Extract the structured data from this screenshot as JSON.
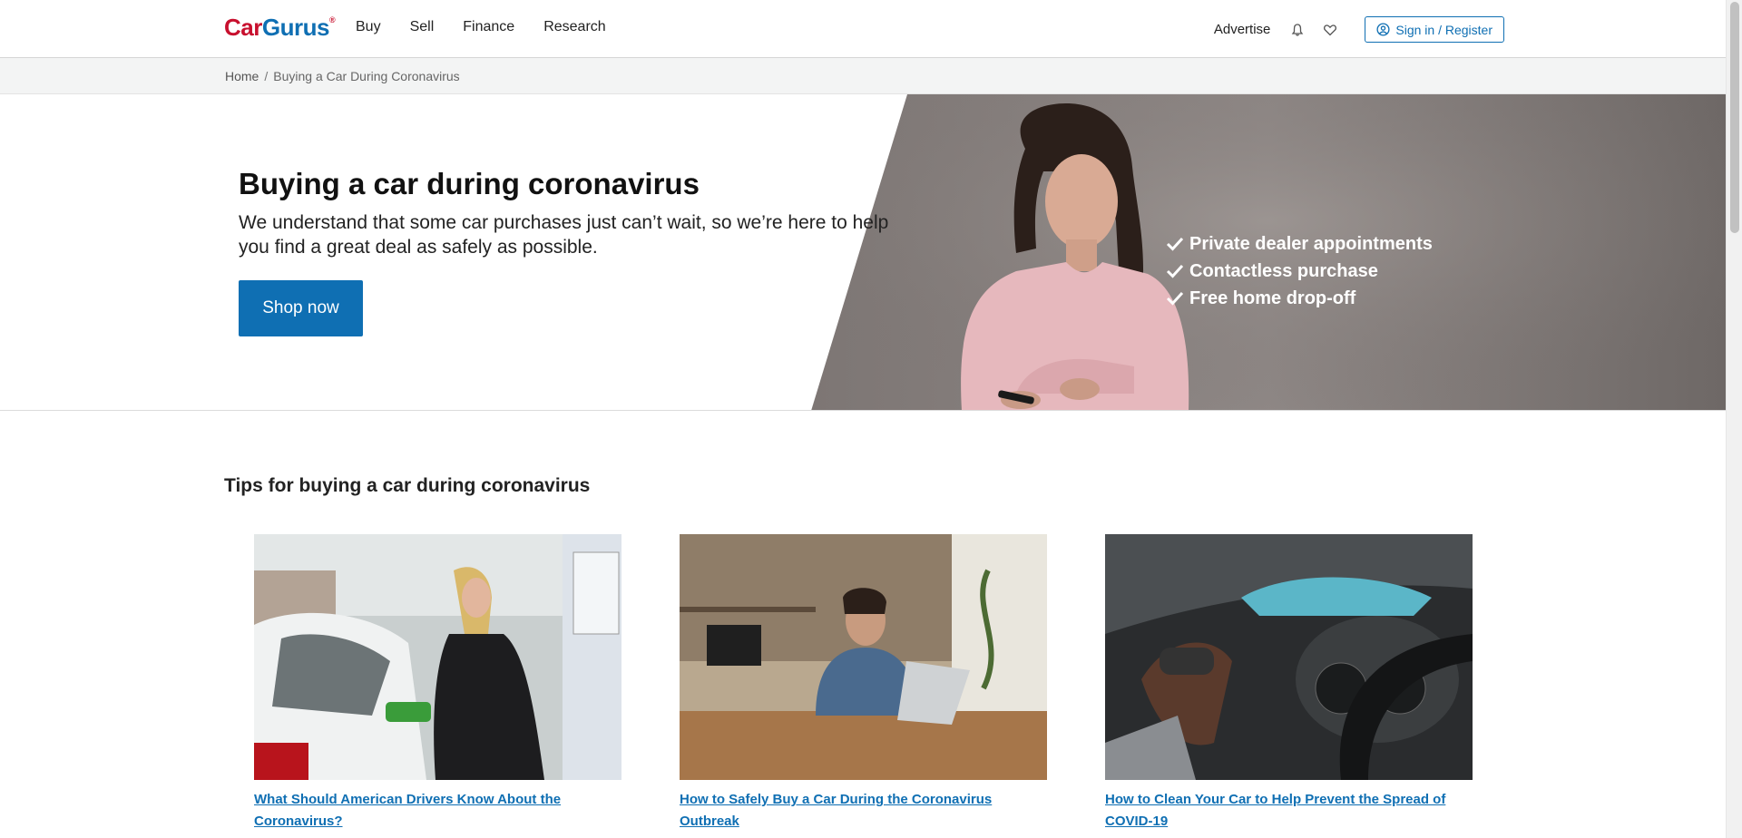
{
  "header": {
    "logo_car": "Car",
    "logo_gurus": "Gurus",
    "logo_mark": "®",
    "nav": [
      "Buy",
      "Sell",
      "Finance",
      "Research"
    ],
    "advertise": "Advertise",
    "signin_label": "Sign in / Register",
    "icons": [
      "bell-icon",
      "heart-icon",
      "user-circle-icon"
    ]
  },
  "breadcrumb": {
    "home": "Home",
    "separator": "/",
    "current": "Buying a Car During Coronavirus"
  },
  "hero": {
    "title": "Buying a car during coronavirus",
    "subtitle": "We understand that some car purchases just can’t wait, so we’re here to help you find a great deal as safely as possible.",
    "cta": "Shop now",
    "checks": [
      "Private dealer appointments",
      "Contactless purchase",
      "Free home drop-off"
    ]
  },
  "tips": {
    "title": "Tips for buying a car during coronavirus",
    "articles": [
      {
        "title": "What Should American Drivers Know About the Coronavirus?"
      },
      {
        "title": "How to Safely Buy a Car During the Coronavirus Outbreak"
      },
      {
        "title": "How to Clean Your Car to Help Prevent the Spread of COVID-19"
      }
    ]
  },
  "colors": {
    "brand_blue": "#0f6fb3",
    "brand_red": "#c8102e",
    "hero_gray": "#8b8481"
  }
}
